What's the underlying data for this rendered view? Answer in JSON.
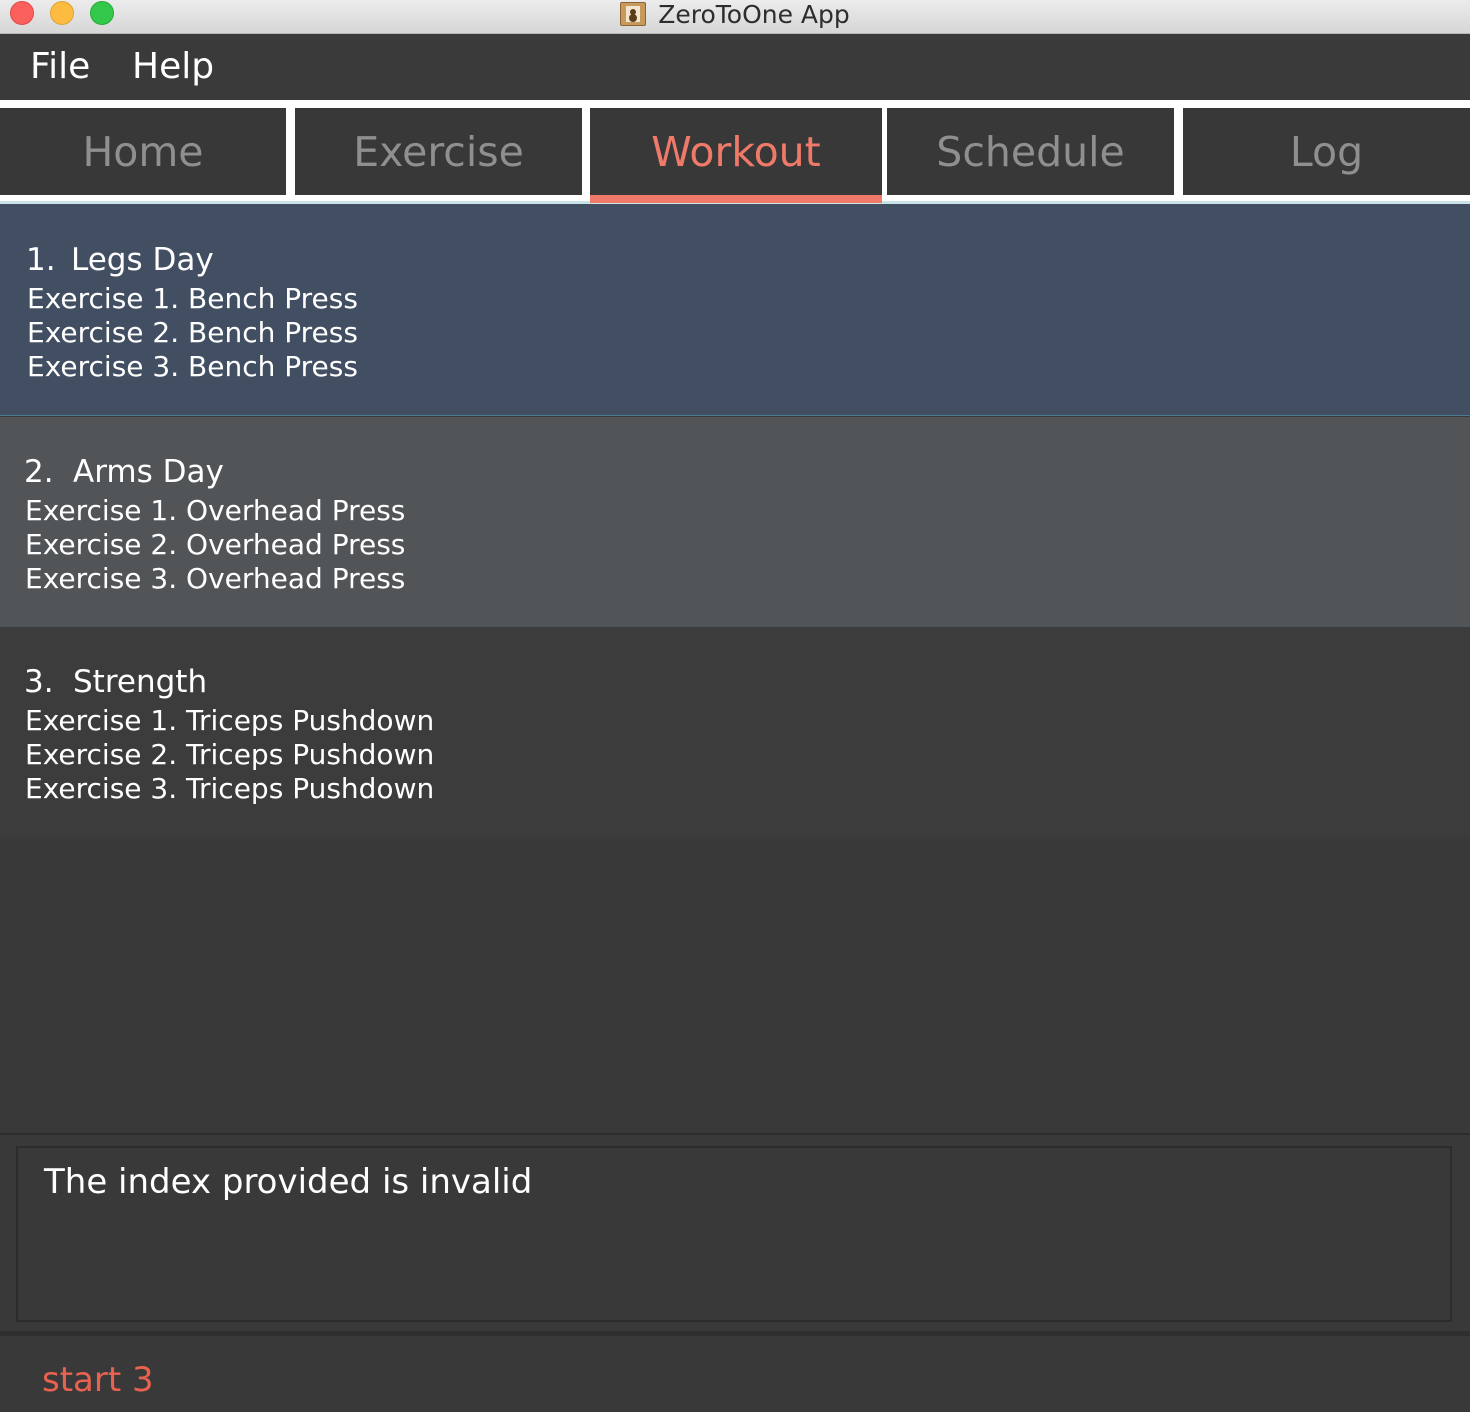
{
  "window": {
    "title": "ZeroToOne App"
  },
  "menu": {
    "file": "File",
    "help": "Help"
  },
  "tabs": [
    {
      "label": "Home",
      "active": false
    },
    {
      "label": "Exercise",
      "active": false
    },
    {
      "label": "Workout",
      "active": true
    },
    {
      "label": "Schedule",
      "active": false
    },
    {
      "label": "Log",
      "active": false
    }
  ],
  "workouts": [
    {
      "index": "1.",
      "name": "Legs Day",
      "exercises": [
        "Exercise 1. Bench Press",
        "Exercise 2. Bench Press",
        "Exercise 3. Bench Press"
      ]
    },
    {
      "index": "2.",
      "name": "Arms Day",
      "exercises": [
        "Exercise 1. Overhead Press",
        "Exercise 2. Overhead Press",
        "Exercise 3. Overhead Press"
      ]
    },
    {
      "index": "3.",
      "name": "Strength",
      "exercises": [
        "Exercise 1. Triceps Pushdown",
        "Exercise 2. Triceps Pushdown",
        "Exercise 3. Triceps Pushdown"
      ]
    }
  ],
  "result": {
    "message": "The index provided is invalid"
  },
  "command": {
    "value": "start 3"
  },
  "colors": {
    "accent": "#f07a6a",
    "selected_card": "#424e62",
    "hover_card": "#515557"
  }
}
